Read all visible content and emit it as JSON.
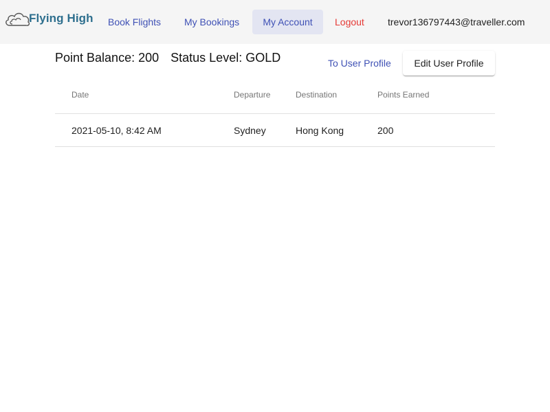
{
  "header": {
    "logo_text": "Flying High",
    "nav": [
      {
        "label": "Book Flights"
      },
      {
        "label": "My Bookings"
      },
      {
        "label": "My Account"
      },
      {
        "label": "Logout"
      }
    ],
    "user_email": "trevor136797443@traveller.com"
  },
  "account": {
    "point_balance": "Point Balance: 200",
    "status_level": "Status Level: GOLD",
    "to_profile_label": "To User Profile",
    "edit_profile_label": "Edit User Profile"
  },
  "table": {
    "columns": [
      "Date",
      "Departure",
      "Destination",
      "Points Earned"
    ],
    "rows": [
      {
        "date": "2021-05-10, 8:42 AM",
        "departure": "Sydney",
        "destination": "Hong Kong",
        "points": "200"
      }
    ]
  },
  "colors": {
    "primary": "#3f51b5",
    "warn": "#e53935",
    "logo": "#2e6f8e",
    "active_nav_bg": "#e3e5f2"
  },
  "icons": {
    "logo": "cloud-icon"
  }
}
